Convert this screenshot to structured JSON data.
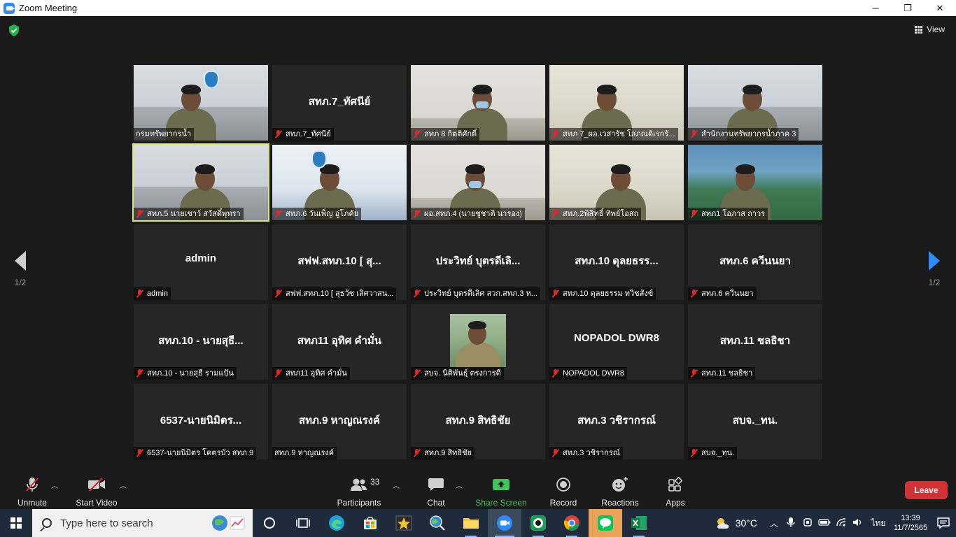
{
  "window": {
    "title": "Zoom Meeting",
    "controls": {
      "minimize": "─",
      "restore": "❐",
      "close": "✕"
    }
  },
  "header": {
    "view_label": "View"
  },
  "pagination": {
    "left": "1/2",
    "right": "1/2"
  },
  "tiles": [
    {
      "center": "",
      "label": "กรมทรัพยากรน้ำ",
      "muted": false,
      "video": "office"
    },
    {
      "center": "สทภ.7_ทัศนีย์",
      "label": "สทภ.7_ทัศนีย์",
      "muted": true,
      "video": ""
    },
    {
      "center": "",
      "label": "สทภ 8 กิตติศักดิ์",
      "muted": true,
      "video": "wall"
    },
    {
      "center": "",
      "label": "สทภ 7_ผอ.เวสารัช โสภณดิเรกรั...",
      "muted": true,
      "video": "beige"
    },
    {
      "center": "",
      "label": "สำนักงานทรัพยากรน้ำภาค 3",
      "muted": true,
      "video": "office"
    },
    {
      "center": "",
      "label": "สทภ.5 นายเชาว์ สวัสดิ์พุทรา",
      "muted": true,
      "video": "office",
      "active": true
    },
    {
      "center": "",
      "label": "สทภ.6 วันเพ็ญ อู่โภคัย",
      "muted": true,
      "video": "blue"
    },
    {
      "center": "",
      "label": "ผอ.สทภ.4 (นายชูชาติ นารอง)",
      "muted": true,
      "video": "wall"
    },
    {
      "center": "",
      "label": "สทภ.2พิสิทธิ์ ทิพย์โอสถ",
      "muted": true,
      "video": "beige"
    },
    {
      "center": "",
      "label": "สทภ1 โอภาส ถาวร",
      "muted": true,
      "video": "scenic"
    },
    {
      "center": "admin",
      "label": "admin",
      "muted": true,
      "video": ""
    },
    {
      "center": "สฟฟ.สทภ.10 [ สุ...",
      "label": "สฟฟ.สทภ.10 [ สุธวัช เลิศวาสน...",
      "muted": true,
      "video": ""
    },
    {
      "center": "ประวิทย์ บุตรดีเลิ...",
      "label": "ประวิทย์ บุตรดีเลิศ สวก.สทภ.3 ห...",
      "muted": true,
      "video": ""
    },
    {
      "center": "สทภ.10 ดุลยธรร...",
      "label": "สทภ.10 ดุลยธรรม ทวิชสังข์",
      "muted": true,
      "video": ""
    },
    {
      "center": "สทภ.6 ควีนนยา",
      "label": "สทภ.6 ควีนนยา",
      "muted": true,
      "video": ""
    },
    {
      "center": "สทภ.10 - นายสุธี...",
      "label": "สทภ.10 - นายสุธี รามแป้น",
      "muted": true,
      "video": ""
    },
    {
      "center": "สทภ11 อุทิศ คำมั่น",
      "label": "สทภ11 อุทิศ คำมั่น",
      "muted": true,
      "video": ""
    },
    {
      "center": "",
      "label": "สบจ. นิติพันธุ์ ตรงการดี",
      "muted": true,
      "video": "photo"
    },
    {
      "center": "NOPADOL DWR8",
      "label": "NOPADOL DWR8",
      "muted": true,
      "video": ""
    },
    {
      "center": "สทภ.11 ชลธิชา",
      "label": "สทภ.11 ชลธิชา",
      "muted": true,
      "video": ""
    },
    {
      "center": "6537-นายนิมิตร...",
      "label": "6537-นายนิมิตร โคตรบัว สทภ.9",
      "muted": true,
      "video": ""
    },
    {
      "center": "สทภ.9 หาญณรงค์",
      "label": "สทภ.9 หาญณรงค์",
      "muted": false,
      "video": ""
    },
    {
      "center": "สทภ.9 สิทธิชัย",
      "label": "สทภ.9 สิทธิชัย",
      "muted": true,
      "video": ""
    },
    {
      "center": "สทภ.3 วชิรากรณ์",
      "label": "สทภ.3 วชิรากรณ์",
      "muted": true,
      "video": ""
    },
    {
      "center": "สบจ._ทน.",
      "label": "สบจ._ทน.",
      "muted": true,
      "video": ""
    }
  ],
  "toolbar": {
    "unmute": "Unmute",
    "start_video": "Start Video",
    "participants": "Participants",
    "participants_count": "33",
    "chat": "Chat",
    "share_screen": "Share Screen",
    "record": "Record",
    "reactions": "Reactions",
    "apps": "Apps",
    "leave": "Leave"
  },
  "taskbar": {
    "search_placeholder": "Type here to search",
    "weather": "30°C",
    "language": "ไทย",
    "time": "13:39",
    "date": "11/7/2565"
  },
  "colors": {
    "accent": "#2D8CFF",
    "leave": "#d13234",
    "share_green": "#40c45a",
    "muted_red": "#e02828",
    "active_speaker": "#d9e86a"
  }
}
